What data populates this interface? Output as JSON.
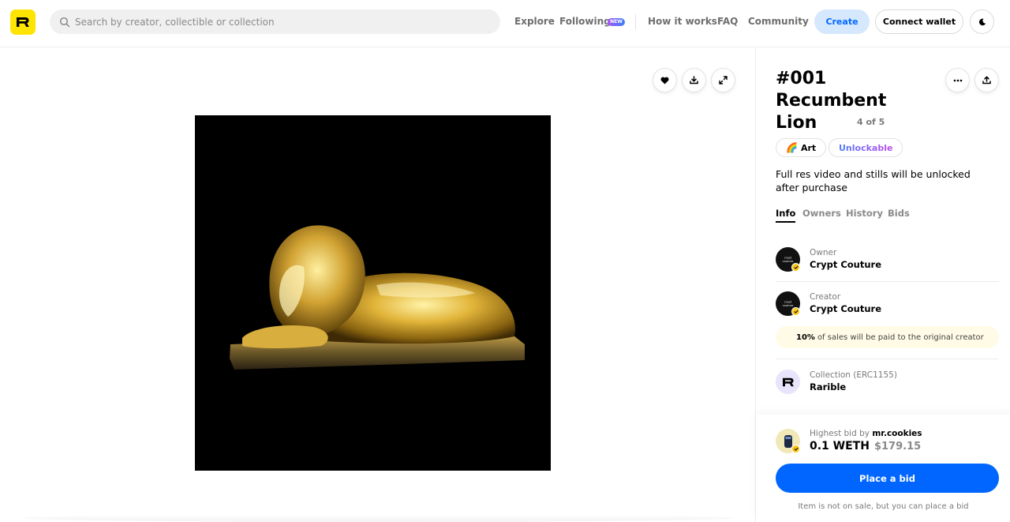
{
  "header": {
    "search_placeholder": "Search by creator, collectible or collection",
    "nav": {
      "explore": "Explore",
      "following": "Following",
      "new_badge": "NEW",
      "how_it_works": "How it works",
      "faq": "FAQ",
      "community": "Community"
    },
    "create_label": "Create",
    "connect_label": "Connect wallet"
  },
  "item": {
    "title": "#001 Recumbent Lion",
    "edition": "4 of 5",
    "category": "Art",
    "category_emoji": "🌈",
    "unlockable_label": "Unlockable",
    "description": "Full res video and stills will be unlocked after purchase"
  },
  "tabs": [
    "Info",
    "Owners",
    "History",
    "Bids"
  ],
  "info": {
    "owner_label": "Owner",
    "owner_name": "Crypt Couture",
    "creator_label": "Creator",
    "creator_name": "Crypt Couture",
    "royalty_percent": "10%",
    "royalty_text": "of sales will be paid to the original creator",
    "collection_label": "Collection (ERC1155)",
    "collection_name": "Rarible"
  },
  "bid": {
    "label_prefix": "Highest bid by",
    "bidder": "mr.cookies",
    "amount": "0.1 WETH",
    "usd": "$179.15",
    "button_label": "Place a bid",
    "note": "Item is not on sale, but you can place a bid"
  },
  "colors": {
    "brand_yellow": "#fee403",
    "primary_blue": "#0066ff",
    "create_bg": "#d5e8fd"
  }
}
